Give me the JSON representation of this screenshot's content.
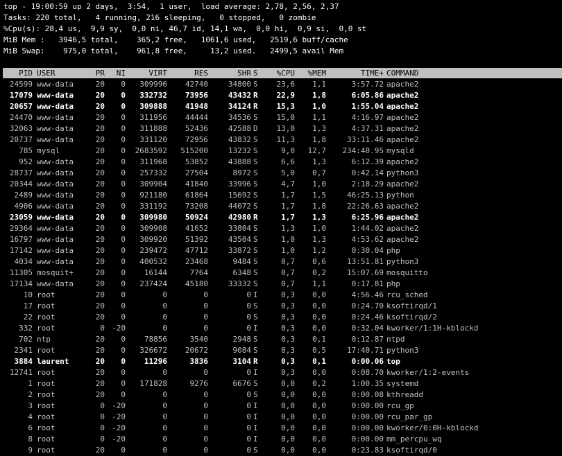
{
  "window": {
    "background": "#000000",
    "text_color": "#c0c0c0",
    "header_bar_color": "#c0c0c0"
  },
  "summary": {
    "line1": "top - 19:00:59 up 2 days,  3:54,  1 user,  load average: 2,78, 2,56, 2,37",
    "line2": "Tasks: 220 total,   4 running, 216 sleeping,   0 stopped,   0 zombie",
    "line3": "%Cpu(s): 28,4 us,  9,9 sy,  0,0 ni, 46,7 id, 14,1 wa,  0,0 hi,  0,9 si,  0,0 st",
    "line4": "MiB Mem :   3946,5 total,    365,2 free,   1061,6 used,   2519,6 buff/cache",
    "line5": "MiB Swap:    975,0 total,    961,8 free,     13,2 used.   2499,5 avail Mem"
  },
  "columns": {
    "pid": "PID",
    "user": "USER",
    "pr": "PR",
    "ni": "NI",
    "virt": "VIRT",
    "res": "RES",
    "shr": "SHR",
    "s": "S",
    "cpu": "%CPU",
    "mem": "%MEM",
    "time": "TIME+",
    "command": "COMMAND"
  },
  "processes": [
    {
      "pid": "24599",
      "user": "www-data",
      "pr": "20",
      "ni": "0",
      "virt": "309996",
      "res": "42740",
      "shr": "34800",
      "s": "S",
      "cpu": "23,6",
      "mem": "1,1",
      "time": "3:57.72",
      "command": "apache2"
    },
    {
      "pid": "17079",
      "user": "www-data",
      "pr": "20",
      "ni": "0",
      "virt": "332732",
      "res": "73956",
      "shr": "43432",
      "s": "R",
      "cpu": "22,9",
      "mem": "1,8",
      "time": "6:05.86",
      "command": "apache2"
    },
    {
      "pid": "20657",
      "user": "www-data",
      "pr": "20",
      "ni": "0",
      "virt": "309888",
      "res": "41948",
      "shr": "34124",
      "s": "R",
      "cpu": "15,3",
      "mem": "1,0",
      "time": "1:55.04",
      "command": "apache2"
    },
    {
      "pid": "24470",
      "user": "www-data",
      "pr": "20",
      "ni": "0",
      "virt": "311956",
      "res": "44444",
      "shr": "34536",
      "s": "S",
      "cpu": "15,0",
      "mem": "1,1",
      "time": "4:16.97",
      "command": "apache2"
    },
    {
      "pid": "32063",
      "user": "www-data",
      "pr": "20",
      "ni": "0",
      "virt": "311888",
      "res": "52436",
      "shr": "42588",
      "s": "D",
      "cpu": "13,0",
      "mem": "1,3",
      "time": "4:37.31",
      "command": "apache2"
    },
    {
      "pid": "20737",
      "user": "www-data",
      "pr": "20",
      "ni": "0",
      "virt": "331120",
      "res": "72956",
      "shr": "43832",
      "s": "S",
      "cpu": "11,3",
      "mem": "1,8",
      "time": "33:11.46",
      "command": "apache2"
    },
    {
      "pid": "785",
      "user": "mysql",
      "pr": "20",
      "ni": "0",
      "virt": "2683592",
      "res": "515200",
      "shr": "13232",
      "s": "S",
      "cpu": "9,0",
      "mem": "12,7",
      "time": "234:40.95",
      "command": "mysqld"
    },
    {
      "pid": "952",
      "user": "www-data",
      "pr": "20",
      "ni": "0",
      "virt": "311968",
      "res": "53852",
      "shr": "43888",
      "s": "S",
      "cpu": "6,6",
      "mem": "1,3",
      "time": "6:12.39",
      "command": "apache2"
    },
    {
      "pid": "28737",
      "user": "www-data",
      "pr": "20",
      "ni": "0",
      "virt": "257332",
      "res": "27504",
      "shr": "8972",
      "s": "S",
      "cpu": "5,0",
      "mem": "0,7",
      "time": "0:42.14",
      "command": "python3"
    },
    {
      "pid": "20344",
      "user": "www-data",
      "pr": "20",
      "ni": "0",
      "virt": "309904",
      "res": "41840",
      "shr": "33996",
      "s": "S",
      "cpu": "4,7",
      "mem": "1,0",
      "time": "2:18.29",
      "command": "apache2"
    },
    {
      "pid": "2489",
      "user": "www-data",
      "pr": "20",
      "ni": "0",
      "virt": "921180",
      "res": "61864",
      "shr": "15692",
      "s": "S",
      "cpu": "1,7",
      "mem": "1,5",
      "time": "46:25.13",
      "command": "python"
    },
    {
      "pid": "4906",
      "user": "www-data",
      "pr": "20",
      "ni": "0",
      "virt": "331192",
      "res": "73208",
      "shr": "44072",
      "s": "S",
      "cpu": "1,7",
      "mem": "1,8",
      "time": "22:26.63",
      "command": "apache2"
    },
    {
      "pid": "23059",
      "user": "www-data",
      "pr": "20",
      "ni": "0",
      "virt": "309980",
      "res": "50924",
      "shr": "42980",
      "s": "R",
      "cpu": "1,7",
      "mem": "1,3",
      "time": "6:25.96",
      "command": "apache2"
    },
    {
      "pid": "29364",
      "user": "www-data",
      "pr": "20",
      "ni": "0",
      "virt": "309908",
      "res": "41652",
      "shr": "33804",
      "s": "S",
      "cpu": "1,3",
      "mem": "1,0",
      "time": "1:44.02",
      "command": "apache2"
    },
    {
      "pid": "16797",
      "user": "www-data",
      "pr": "20",
      "ni": "0",
      "virt": "309920",
      "res": "51392",
      "shr": "43504",
      "s": "S",
      "cpu": "1,0",
      "mem": "1,3",
      "time": "4:53.62",
      "command": "apache2"
    },
    {
      "pid": "17142",
      "user": "www-data",
      "pr": "20",
      "ni": "0",
      "virt": "239472",
      "res": "47712",
      "shr": "33872",
      "s": "S",
      "cpu": "1,0",
      "mem": "1,2",
      "time": "0:30.04",
      "command": "php"
    },
    {
      "pid": "4034",
      "user": "www-data",
      "pr": "20",
      "ni": "0",
      "virt": "400532",
      "res": "23468",
      "shr": "9484",
      "s": "S",
      "cpu": "0,7",
      "mem": "0,6",
      "time": "13:51.81",
      "command": "python3"
    },
    {
      "pid": "11305",
      "user": "mosquit+",
      "pr": "20",
      "ni": "0",
      "virt": "16144",
      "res": "7764",
      "shr": "6348",
      "s": "S",
      "cpu": "0,7",
      "mem": "0,2",
      "time": "15:07.69",
      "command": "mosquitto"
    },
    {
      "pid": "17134",
      "user": "www-data",
      "pr": "20",
      "ni": "0",
      "virt": "237424",
      "res": "45180",
      "shr": "33332",
      "s": "S",
      "cpu": "0,7",
      "mem": "1,1",
      "time": "0:17.81",
      "command": "php"
    },
    {
      "pid": "10",
      "user": "root",
      "pr": "20",
      "ni": "0",
      "virt": "0",
      "res": "0",
      "shr": "0",
      "s": "I",
      "cpu": "0,3",
      "mem": "0,0",
      "time": "4:56.46",
      "command": "rcu_sched"
    },
    {
      "pid": "17",
      "user": "root",
      "pr": "20",
      "ni": "0",
      "virt": "0",
      "res": "0",
      "shr": "0",
      "s": "S",
      "cpu": "0,3",
      "mem": "0,0",
      "time": "0:24.70",
      "command": "ksoftirqd/1"
    },
    {
      "pid": "22",
      "user": "root",
      "pr": "20",
      "ni": "0",
      "virt": "0",
      "res": "0",
      "shr": "0",
      "s": "S",
      "cpu": "0,3",
      "mem": "0,0",
      "time": "0:24.46",
      "command": "ksoftirqd/2"
    },
    {
      "pid": "332",
      "user": "root",
      "pr": "0",
      "ni": "-20",
      "virt": "0",
      "res": "0",
      "shr": "0",
      "s": "I",
      "cpu": "0,3",
      "mem": "0,0",
      "time": "0:32.04",
      "command": "kworker/1:1H-kblockd"
    },
    {
      "pid": "702",
      "user": "ntp",
      "pr": "20",
      "ni": "0",
      "virt": "78856",
      "res": "3540",
      "shr": "2948",
      "s": "S",
      "cpu": "0,3",
      "mem": "0,1",
      "time": "0:12.87",
      "command": "ntpd"
    },
    {
      "pid": "2341",
      "user": "root",
      "pr": "20",
      "ni": "0",
      "virt": "326672",
      "res": "20672",
      "shr": "9084",
      "s": "S",
      "cpu": "0,3",
      "mem": "0,5",
      "time": "17:40.71",
      "command": "python3"
    },
    {
      "pid": "3884",
      "user": "laurent",
      "pr": "20",
      "ni": "0",
      "virt": "11296",
      "res": "3836",
      "shr": "3104",
      "s": "R",
      "cpu": "0,3",
      "mem": "0,1",
      "time": "0:00.06",
      "command": "top"
    },
    {
      "pid": "12741",
      "user": "root",
      "pr": "20",
      "ni": "0",
      "virt": "0",
      "res": "0",
      "shr": "0",
      "s": "I",
      "cpu": "0,3",
      "mem": "0,0",
      "time": "0:08.70",
      "command": "kworker/1:2-events"
    },
    {
      "pid": "1",
      "user": "root",
      "pr": "20",
      "ni": "0",
      "virt": "171828",
      "res": "9276",
      "shr": "6676",
      "s": "S",
      "cpu": "0,0",
      "mem": "0,2",
      "time": "1:00.35",
      "command": "systemd"
    },
    {
      "pid": "2",
      "user": "root",
      "pr": "20",
      "ni": "0",
      "virt": "0",
      "res": "0",
      "shr": "0",
      "s": "S",
      "cpu": "0,0",
      "mem": "0,0",
      "time": "0:00.08",
      "command": "kthreadd"
    },
    {
      "pid": "3",
      "user": "root",
      "pr": "0",
      "ni": "-20",
      "virt": "0",
      "res": "0",
      "shr": "0",
      "s": "I",
      "cpu": "0,0",
      "mem": "0,0",
      "time": "0:00.00",
      "command": "rcu_gp"
    },
    {
      "pid": "4",
      "user": "root",
      "pr": "0",
      "ni": "-20",
      "virt": "0",
      "res": "0",
      "shr": "0",
      "s": "I",
      "cpu": "0,0",
      "mem": "0,0",
      "time": "0:00.00",
      "command": "rcu_par_gp"
    },
    {
      "pid": "6",
      "user": "root",
      "pr": "0",
      "ni": "-20",
      "virt": "0",
      "res": "0",
      "shr": "0",
      "s": "I",
      "cpu": "0,0",
      "mem": "0,0",
      "time": "0:00.00",
      "command": "kworker/0:0H-kblockd"
    },
    {
      "pid": "8",
      "user": "root",
      "pr": "0",
      "ni": "-20",
      "virt": "0",
      "res": "0",
      "shr": "0",
      "s": "I",
      "cpu": "0,0",
      "mem": "0,0",
      "time": "0:00.00",
      "command": "mm_percpu_wq"
    },
    {
      "pid": "9",
      "user": "root",
      "pr": "20",
      "ni": "0",
      "virt": "0",
      "res": "0",
      "shr": "0",
      "s": "S",
      "cpu": "0,0",
      "mem": "0,0",
      "time": "0:23.83",
      "command": "ksoftirqd/0"
    }
  ]
}
